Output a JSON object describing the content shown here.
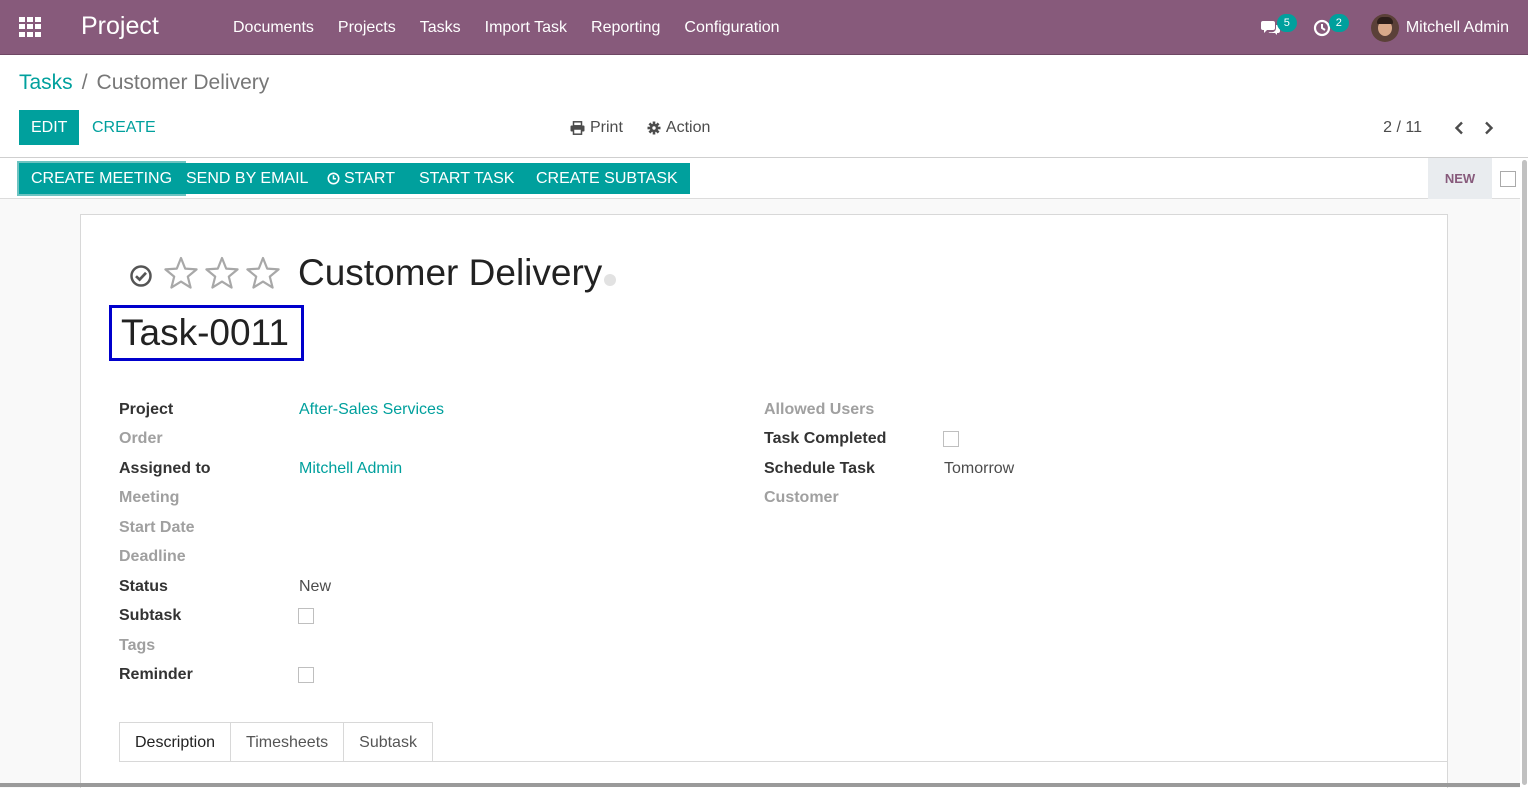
{
  "topbar": {
    "app_name": "Project",
    "menu": [
      "Documents",
      "Projects",
      "Tasks",
      "Import Task",
      "Reporting",
      "Configuration"
    ],
    "messages_count": "5",
    "activities_count": "2",
    "user_name": "Mitchell Admin",
    "bg_color": "#875a7b"
  },
  "breadcrumb": {
    "parent": "Tasks",
    "separator": "/",
    "current": "Customer Delivery"
  },
  "toolbar": {
    "edit_label": "EDIT",
    "create_label": "CREATE",
    "print_label": "Print",
    "action_label": "Action",
    "pager": "2 / 11"
  },
  "header_buttons": {
    "create_meeting": "CREATE MEETING",
    "send_by_email": "SEND BY EMAIL",
    "start": "START",
    "start_task": "START TASK",
    "create_subtask": "CREATE SUBTASK",
    "stage": "NEW"
  },
  "record": {
    "title": "Customer Delivery",
    "reference": "Task-0011",
    "priority_stars": 3,
    "priority_value": 0
  },
  "fields_left": [
    {
      "label": "Project",
      "value": "After-Sales Services",
      "type": "link",
      "required": true
    },
    {
      "label": "Order",
      "value": "",
      "type": "text",
      "required": false
    },
    {
      "label": "Assigned to",
      "value": "Mitchell Admin",
      "type": "link",
      "required": true
    },
    {
      "label": "Meeting",
      "value": "",
      "type": "text",
      "required": false
    },
    {
      "label": "Start Date",
      "value": "",
      "type": "text",
      "required": false
    },
    {
      "label": "Deadline",
      "value": "",
      "type": "text",
      "required": false
    },
    {
      "label": "Status",
      "value": "New",
      "type": "text",
      "required": true
    },
    {
      "label": "Subtask",
      "value": "",
      "type": "checkbox",
      "required": true
    },
    {
      "label": "Tags",
      "value": "",
      "type": "text",
      "required": false
    },
    {
      "label": "Reminder",
      "value": "",
      "type": "checkbox",
      "required": true
    }
  ],
  "fields_right": [
    {
      "label": "Allowed Users",
      "value": "",
      "type": "text",
      "required": false
    },
    {
      "label": "Task Completed",
      "value": "",
      "type": "checkbox",
      "required": true
    },
    {
      "label": "Schedule Task",
      "value": "Tomorrow",
      "type": "text",
      "required": true
    },
    {
      "label": "Customer",
      "value": "",
      "type": "text",
      "required": false
    }
  ],
  "tabs": [
    {
      "label": "Description",
      "active": true
    },
    {
      "label": "Timesheets",
      "active": false
    },
    {
      "label": "Subtask",
      "active": false
    }
  ],
  "colors": {
    "primary": "#00a09d",
    "brand": "#875a7b",
    "highlight_box": "#0000cc"
  }
}
